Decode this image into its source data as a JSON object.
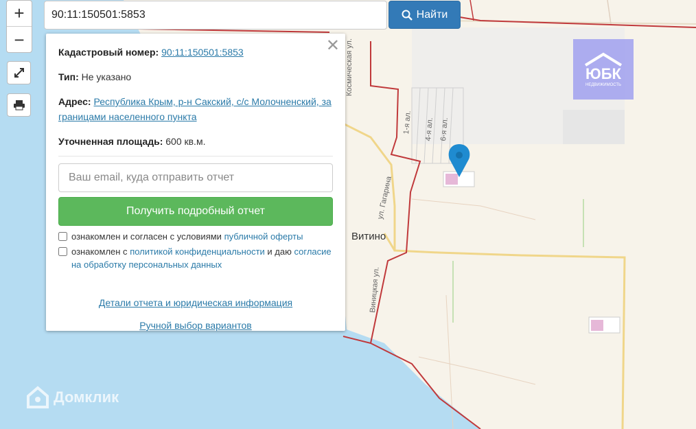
{
  "search": {
    "value": "90:11:150501:5853",
    "button_label": "Найти"
  },
  "zoom": {
    "in_label": "+",
    "out_label": "−"
  },
  "popup": {
    "cadastral_label": "Кадастровый номер:",
    "cadastral_value": "90:11:150501:5853",
    "type_label": "Тип:",
    "type_value": "Не указано",
    "address_label": "Адрес:",
    "address_value": "Республика Крым, р-н Сакский, с/с Молочненский, за границами населенного пункта",
    "area_label": "Уточненная площадь:",
    "area_value": "600 кв.м.",
    "email_placeholder": "Ваш email, куда отправить отчет",
    "report_button": "Получить подробный отчет",
    "check1_text": "ознакомлен и согласен с условиями",
    "check1_link": "публичной оферты",
    "check2_text": "ознакомлен с",
    "check2_link": "политикой конфиденциальности",
    "check2_mid": "и даю",
    "check2_link2": "согласие на обработку персональных данных",
    "details_link": "Детали отчета и юридическая информация",
    "manual_link": "Ручной выбор вариантов"
  },
  "map_labels": {
    "street1": "Космическая ул.",
    "street2": "ул. Гагарина",
    "street3": "Виницкая ул.",
    "alley1": "1-я ал.",
    "alley4": "4-я ал.",
    "alley6": "6-я ал.",
    "village": "Витино"
  },
  "watermark": {
    "brand": "ЮБК",
    "sub": "НЕДВИЖИМОСТЬ"
  },
  "logo": {
    "text": "Домклик"
  },
  "colors": {
    "sea": "#b5dcf2",
    "land": "#f7f3ea",
    "boundary": "#c0393b",
    "marker": "#1f8bd0",
    "search_button": "#337ab7",
    "report_button": "#5cb85c"
  },
  "icons": [
    "search-icon",
    "fullscreen-icon",
    "print-icon",
    "close-icon",
    "map-marker-icon"
  ]
}
